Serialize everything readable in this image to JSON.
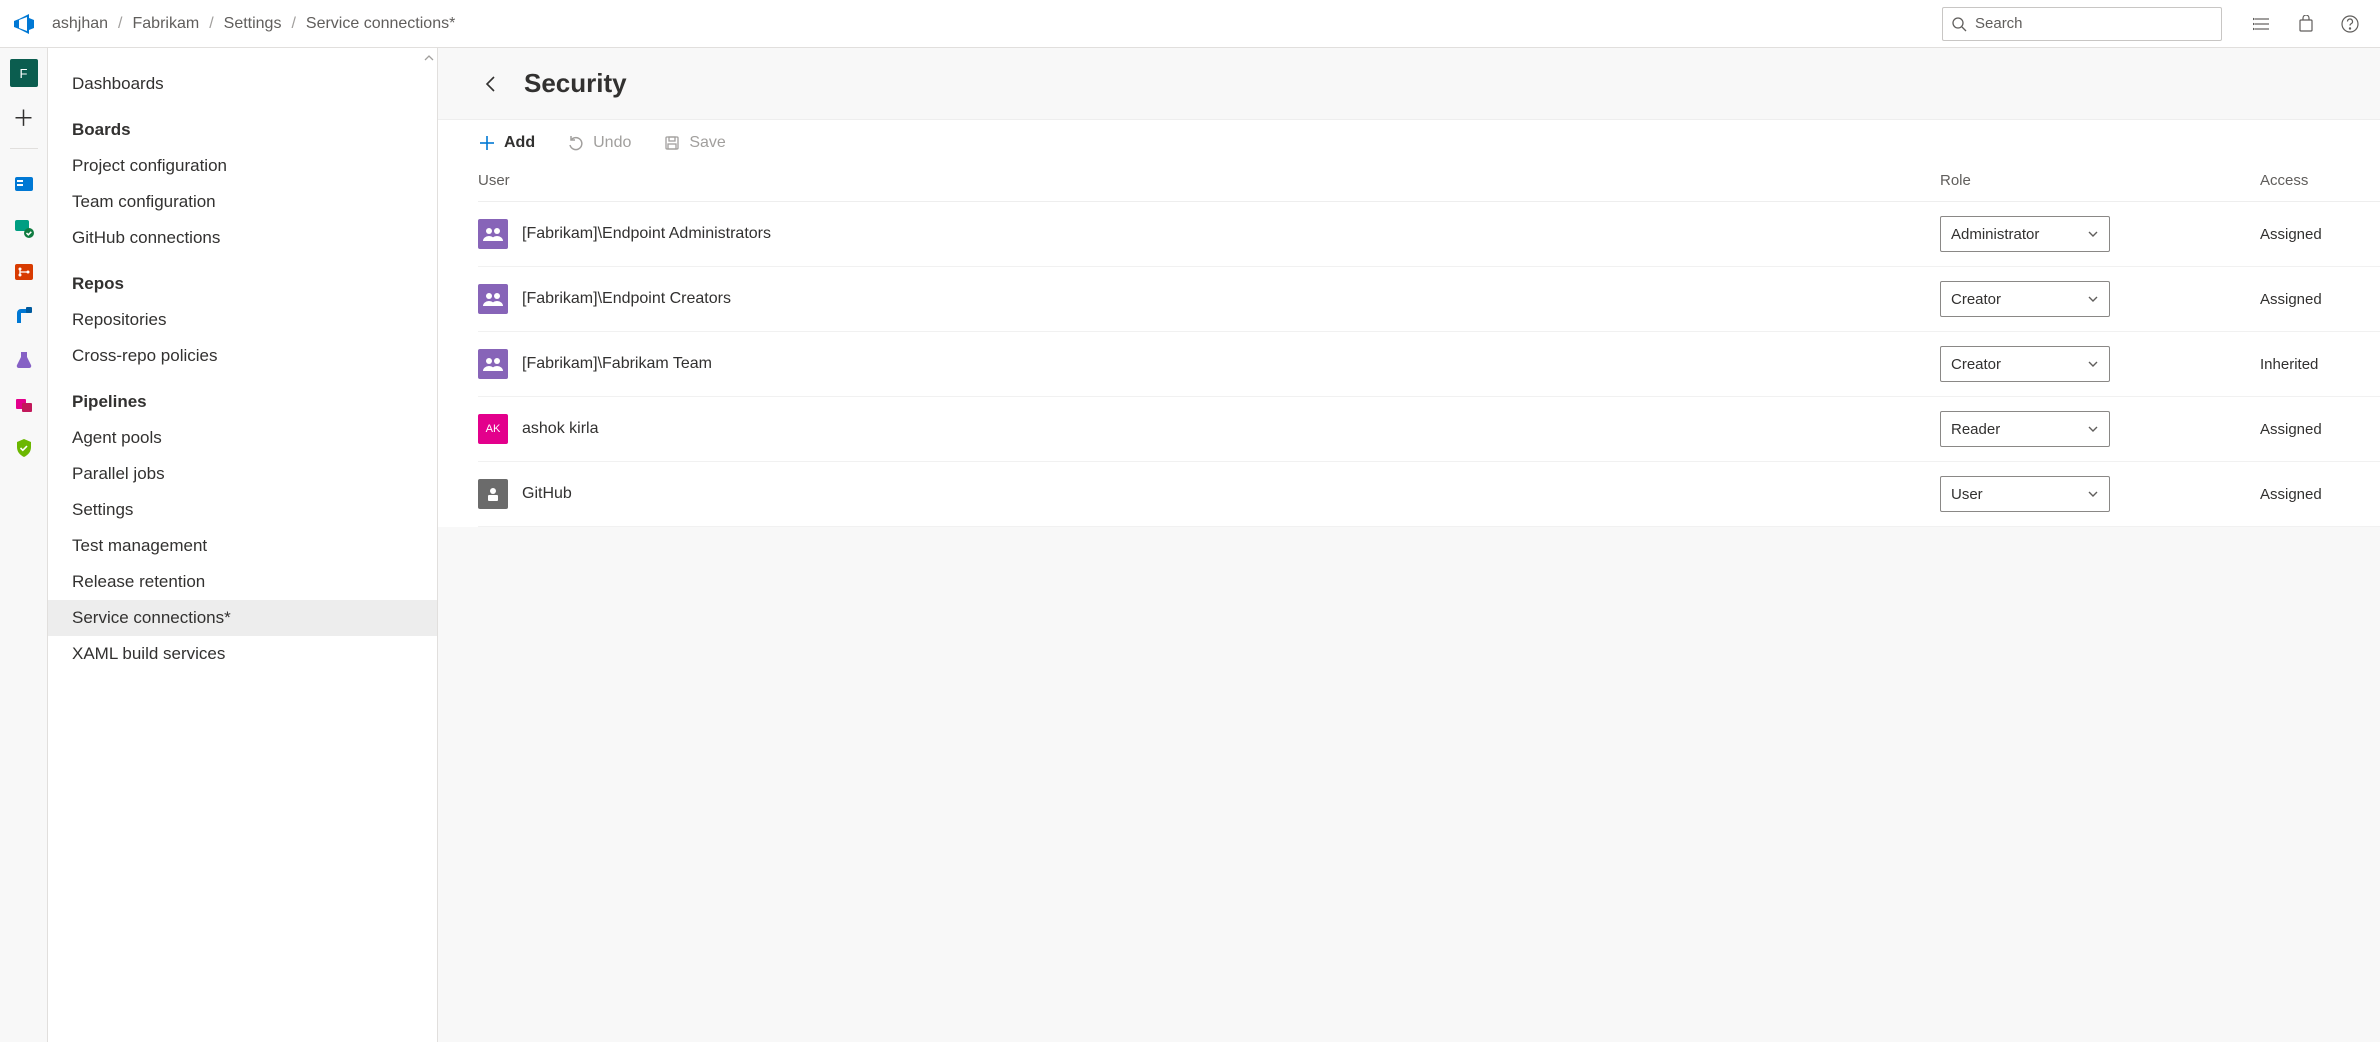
{
  "breadcrumbs": [
    "ashjhan",
    "Fabrikam",
    "Settings",
    "Service connections*"
  ],
  "search": {
    "placeholder": "Search"
  },
  "rail": {
    "project_initial": "F"
  },
  "sidebar": {
    "items": [
      {
        "type": "link",
        "label": "Dashboards"
      },
      {
        "type": "heading",
        "label": "Boards"
      },
      {
        "type": "link",
        "label": "Project configuration"
      },
      {
        "type": "link",
        "label": "Team configuration"
      },
      {
        "type": "link",
        "label": "GitHub connections"
      },
      {
        "type": "heading",
        "label": "Repos"
      },
      {
        "type": "link",
        "label": "Repositories"
      },
      {
        "type": "link",
        "label": "Cross-repo policies"
      },
      {
        "type": "heading",
        "label": "Pipelines"
      },
      {
        "type": "link",
        "label": "Agent pools"
      },
      {
        "type": "link",
        "label": "Parallel jobs"
      },
      {
        "type": "link",
        "label": "Settings"
      },
      {
        "type": "link",
        "label": "Test management"
      },
      {
        "type": "link",
        "label": "Release retention"
      },
      {
        "type": "link",
        "label": "Service connections*",
        "selected": true
      },
      {
        "type": "link",
        "label": "XAML build services"
      }
    ]
  },
  "main": {
    "title": "Security",
    "commands": {
      "add": "Add",
      "undo": "Undo",
      "save": "Save"
    },
    "columns": {
      "user": "User",
      "role": "Role",
      "access": "Access"
    },
    "rows": [
      {
        "avatar_kind": "group",
        "avatar_text": "",
        "user": "[Fabrikam]\\Endpoint Administrators",
        "role": "Administrator",
        "access": "Assigned"
      },
      {
        "avatar_kind": "group",
        "avatar_text": "",
        "user": "[Fabrikam]\\Endpoint Creators",
        "role": "Creator",
        "access": "Assigned"
      },
      {
        "avatar_kind": "group",
        "avatar_text": "",
        "user": "[Fabrikam]\\Fabrikam Team",
        "role": "Creator",
        "access": "Inherited"
      },
      {
        "avatar_kind": "ak",
        "avatar_text": "AK",
        "user": "ashok kirla",
        "role": "Reader",
        "access": "Assigned"
      },
      {
        "avatar_kind": "svc",
        "avatar_text": "",
        "user": "GitHub",
        "role": "User",
        "access": "Assigned"
      }
    ]
  }
}
